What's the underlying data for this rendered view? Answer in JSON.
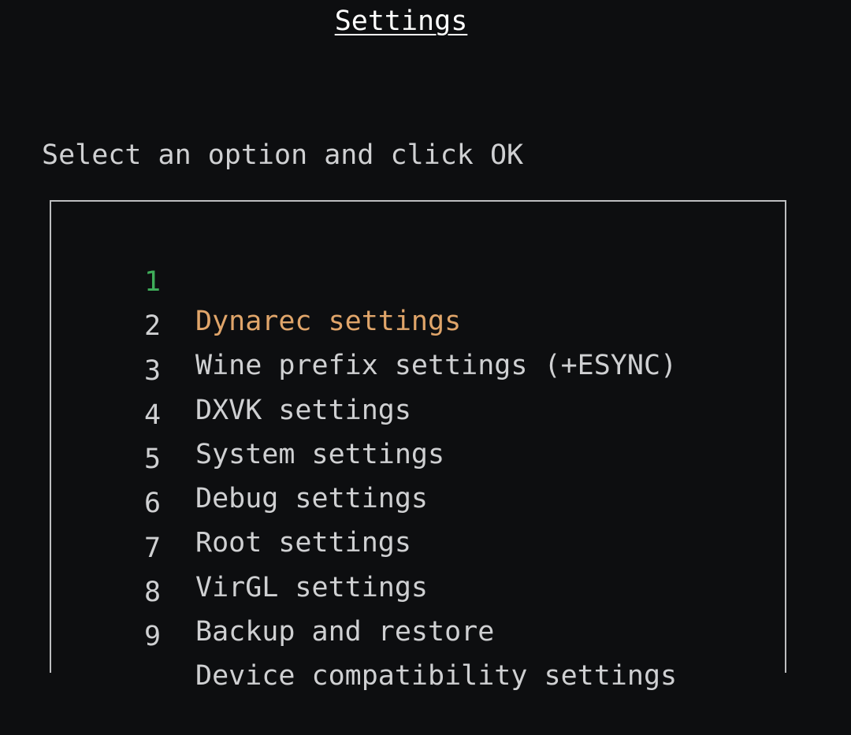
{
  "header": {
    "title": "Settings"
  },
  "prompt": {
    "text": "Select an option and click OK"
  },
  "menu": {
    "selected_index": 0,
    "items": [
      {
        "number": "1",
        "label": "Dynarec settings"
      },
      {
        "number": "2",
        "label": "Wine prefix settings (+ESYNC)"
      },
      {
        "number": "3",
        "label": "DXVK settings"
      },
      {
        "number": "4",
        "label": "System settings"
      },
      {
        "number": "5",
        "label": "Debug settings"
      },
      {
        "number": "6",
        "label": "Root settings"
      },
      {
        "number": "7",
        "label": "VirGL settings"
      },
      {
        "number": "8",
        "label": "Backup and restore"
      },
      {
        "number": "9",
        "label": "Device compatibility settings"
      }
    ]
  },
  "colors": {
    "background": "#0d0e10",
    "text": "#cfd0d2",
    "title": "#ffffff",
    "selected_number": "#3fae5a",
    "selected_label": "#e0a56a",
    "border": "#bdbec0"
  }
}
